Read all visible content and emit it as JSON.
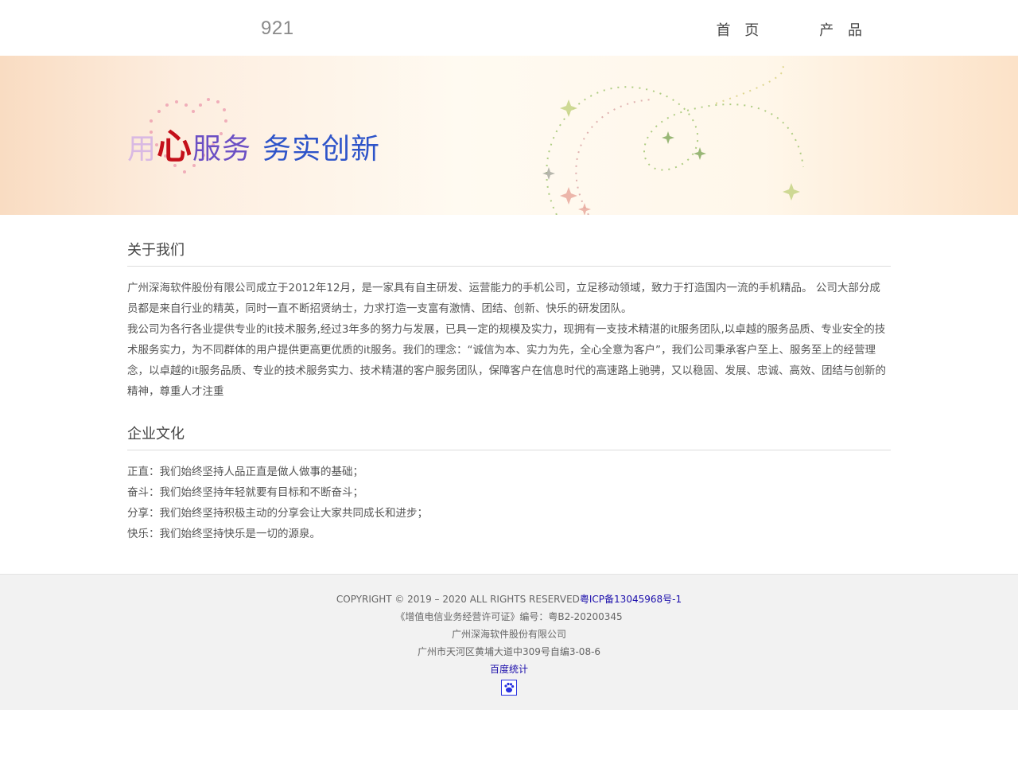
{
  "header": {
    "logo": "921",
    "nav": [
      {
        "label": "首 页"
      },
      {
        "label": "产 品"
      }
    ]
  },
  "banner": {
    "slogan_1": "用",
    "slogan_2": "心",
    "slogan_3": "服务",
    "slogan_4": "务实创新"
  },
  "about": {
    "title": "关于我们",
    "paragraphs": [
      "广州深海软件股份有限公司成立于2012年12月，是一家具有自主研发、运营能力的手机公司，立足移动领域，致力于打造国内一流的手机精品。 公司大部分成员都是来自行业的精英，同时一直不断招贤纳士，力求打造一支富有激情、团结、创新、快乐的研发团队。",
      "我公司为各行各业提供专业的it技术服务,经过3年多的努力与发展，已具一定的规模及实力，现拥有一支技术精湛的it服务团队,以卓越的服务品质、专业安全的技术服务实力，为不同群体的用户提供更高更优质的it服务。我们的理念：“诚信为本、实力为先，全心全意为客户”，我们公司秉承客户至上、服务至上的经营理念，以卓越的it服务品质、专业的技术服务实力、技术精湛的客户服务团队，保障客户在信息时代的高速路上驰骋，又以稳固、发展、忠诚、高效、团结与创新的精神，尊重人才注重"
    ]
  },
  "culture": {
    "title": "企业文化",
    "lines": [
      "正直：我们始终坚持人品正直是做人做事的基础；",
      "奋斗：我们始终坚持年轻就要有目标和不断奋斗；",
      "分享：我们始终坚持积极主动的分享会让大家共同成长和进步；",
      "快乐：我们始终坚持快乐是一切的源泉。"
    ]
  },
  "footer": {
    "copyright": "COPYRIGHT © 2019 – 2020 ALL RIGHTS RESERVED",
    "icp": "粤ICP备13045968号-1",
    "license": "《增值电信业务经营许可证》编号：粤B2-20200345",
    "company": "广州深海软件股份有限公司",
    "address": "广州市天河区黄埔大道中309号自编3-08-6",
    "stats": "百度统计",
    "stats_icon": "baidu-paw-icon"
  }
}
